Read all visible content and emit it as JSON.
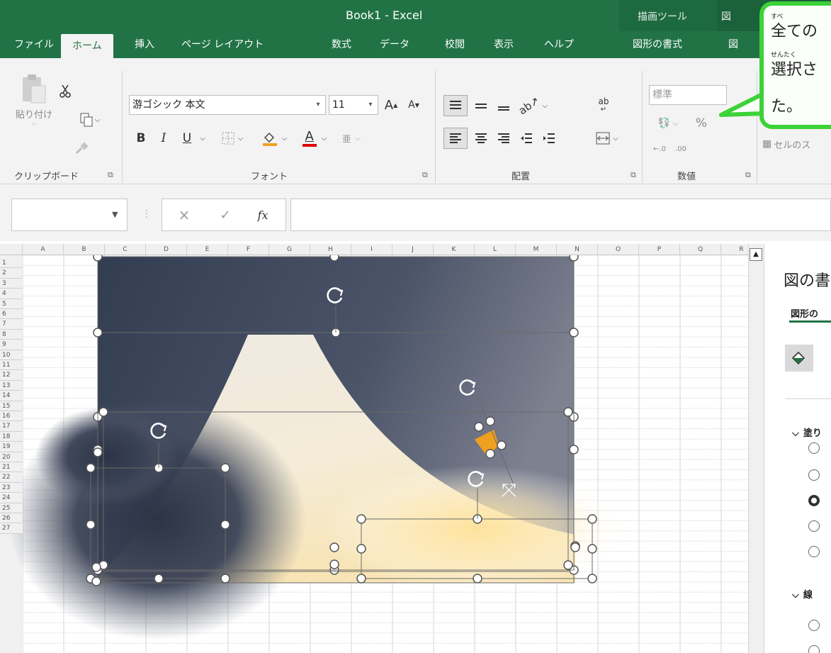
{
  "window": {
    "title": "Book1  -  Excel",
    "context_tab_draw_tools": "描画ツール",
    "context_tab_picture_tools": "図"
  },
  "quick_access": {
    "save_icon": "save-icon",
    "undo_icon": "undo-icon",
    "redo_icon": "redo-icon",
    "customize_icon": "customize-icon"
  },
  "ribbon_tabs": [
    {
      "label": "ファイル"
    },
    {
      "label": "ホーム"
    },
    {
      "label": "挿入"
    },
    {
      "label": "ページ レイアウト"
    },
    {
      "label": "数式"
    },
    {
      "label": "データ"
    },
    {
      "label": "校閲"
    },
    {
      "label": "表示"
    },
    {
      "label": "ヘルプ"
    },
    {
      "label": "図形の書式"
    },
    {
      "label": "図"
    }
  ],
  "clipboard": {
    "paste_label": "貼り付け",
    "group_label": "クリップボード"
  },
  "font": {
    "font_name": "游ゴシック 本文",
    "font_size": "11",
    "bold": "B",
    "italic": "I",
    "underline": "U",
    "font_color_glyph": "A",
    "grow_glyph": "A",
    "shrink_glyph": "A",
    "group_label": "フォント"
  },
  "alignment": {
    "wrap_glyph": "ab",
    "group_label": "配置"
  },
  "number": {
    "format": "標準",
    "percent": "%",
    "group_label": "数値"
  },
  "styles": {
    "cell_styles_label": "セルのス"
  },
  "formula_bar": {
    "cancel": "×",
    "enter": "✓",
    "fx": "fx",
    "name_box_value": "",
    "formula_value": ""
  },
  "sheet": {
    "columns": [
      "A",
      "B",
      "C",
      "D",
      "E",
      "F",
      "G",
      "H",
      "I",
      "J",
      "K",
      "L",
      "M",
      "N",
      "O",
      "P",
      "Q",
      "R"
    ],
    "rows": [
      "1",
      "2",
      "3",
      "4",
      "5",
      "6",
      "7",
      "8",
      "9",
      "10",
      "11",
      "12",
      "13",
      "14",
      "15",
      "16",
      "17",
      "18",
      "19",
      "20",
      "21",
      "22",
      "23",
      "24",
      "25",
      "26",
      "27"
    ]
  },
  "task_pane": {
    "title": "図の書",
    "tab_label": "図形の",
    "fill_section": "塗り",
    "line_section": "線",
    "fill_options_selected_index": 2
  },
  "callout": {
    "line1_ruby": "すべ",
    "line1": "全ての",
    "line2_ruby": "せんたく",
    "line2": "選択さ",
    "line3": "た。"
  },
  "colors": {
    "excel_green": "#217346",
    "callout_border": "#3cd238",
    "font_color_red": "#e00000",
    "fill_color_orange": "#f0a020"
  }
}
